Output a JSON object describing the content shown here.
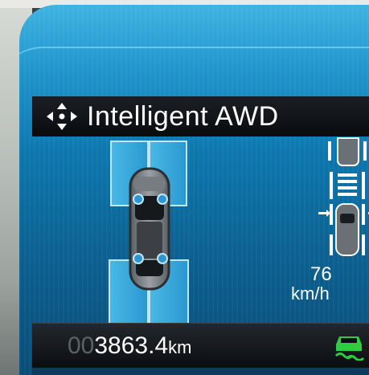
{
  "header": {
    "title": "Intelligent AWD",
    "title_icon": "awd-arrows-icon"
  },
  "drivetrain": {
    "diagram": "car-top-view-awd",
    "wheels": [
      "front-left",
      "front-right",
      "rear-left",
      "rear-right"
    ]
  },
  "side_panel": {
    "icons": [
      "car-rear-icon",
      "lane-lines-icon",
      "car-distance-icon"
    ],
    "speed_value": "76",
    "speed_unit": "km/h"
  },
  "odometer": {
    "leading_digits": "00",
    "value": "3863.4",
    "unit": "km"
  },
  "status": {
    "icon": "stability-control-icon",
    "icon_color": "#2ecc40"
  },
  "colors": {
    "screen_blue": "#1f95cc",
    "bar_black": "#0b0d10",
    "text_white": "#ffffff",
    "accent_green": "#2ecc40"
  }
}
